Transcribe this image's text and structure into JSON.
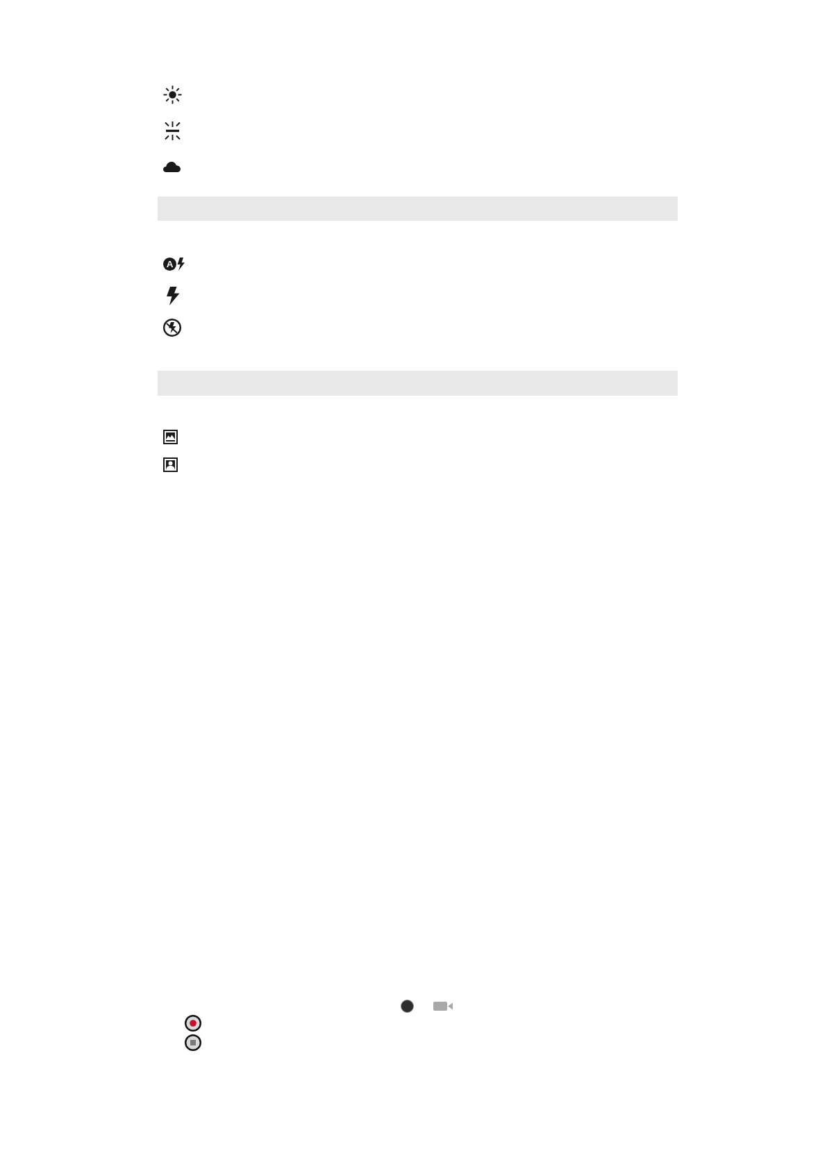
{
  "blocks": [
    {
      "kind": "icon_list",
      "icons": [
        {
          "kind": "sun"
        },
        {
          "kind": "fluorescent"
        },
        {
          "kind": "cloud"
        }
      ]
    },
    {
      "kind": "bar"
    },
    {
      "kind": "icon_list",
      "icons": [
        {
          "kind": "flash-auto",
          "letter": "A"
        },
        {
          "kind": "flash-on"
        },
        {
          "kind": "flash-off"
        }
      ]
    },
    {
      "kind": "bar"
    },
    {
      "kind": "icon_list",
      "icons": [
        {
          "kind": "landscape"
        },
        {
          "kind": "portrait"
        }
      ]
    }
  ],
  "inline_icons": [
    {
      "kind": "shutter-dot"
    },
    {
      "kind": "video-camera"
    }
  ],
  "button_icons": [
    {
      "kind": "record"
    },
    {
      "kind": "stop"
    }
  ]
}
